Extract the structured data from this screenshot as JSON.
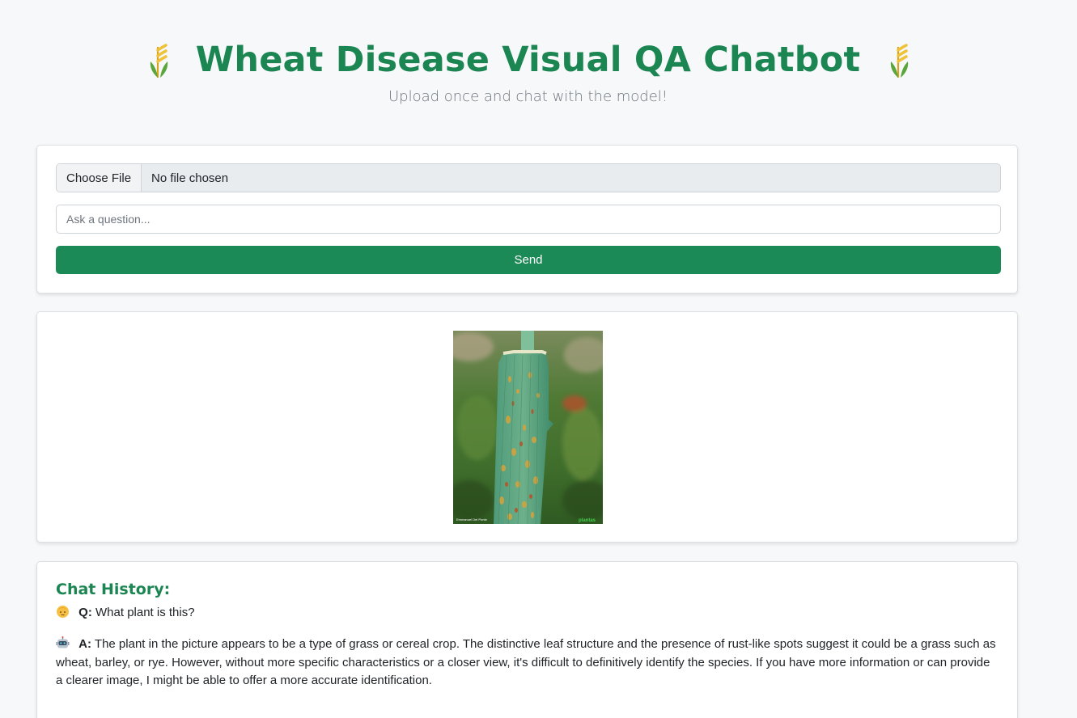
{
  "header": {
    "title": "Wheat Disease Visual QA Chatbot",
    "subtitle": "Upload once and chat with the model!",
    "left_icon": "wheat-icon",
    "right_icon": "wheat-icon"
  },
  "form": {
    "file_button_label": "Choose File",
    "file_status": "No file chosen",
    "question_placeholder": "Ask a question...",
    "question_value": "",
    "send_label": "Send"
  },
  "uploaded_image": {
    "alt": "Wheat leaf with rust spots",
    "caption_left": "Emmanuel Del Ponte",
    "caption_right": "plantas"
  },
  "chat": {
    "heading": "Chat History:",
    "messages": [
      {
        "role": "user",
        "icon": "person-icon",
        "prefix": "Q:",
        "text": "What plant is this?"
      },
      {
        "role": "bot",
        "icon": "robot-icon",
        "prefix": "A:",
        "text": "The plant in the picture appears to be a type of grass or cereal crop. The distinctive leaf structure and the presence of rust-like spots suggest it could be a grass such as wheat, barley, or rye. However, without more specific characteristics or a closer view, it's difficult to definitively identify the species. If you have more information or can provide a clearer image, I might be able to offer a more accurate identification."
      }
    ]
  },
  "colors": {
    "brand_green": "#1c8653",
    "button_green": "#1c8a57",
    "background": "#f7f8fa"
  }
}
